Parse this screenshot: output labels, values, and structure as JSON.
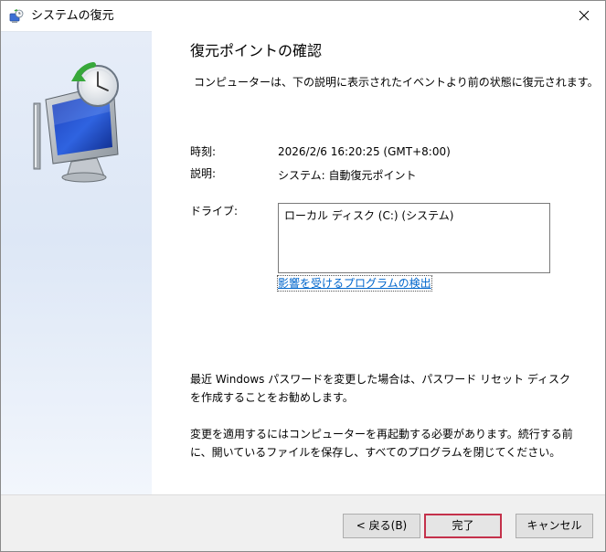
{
  "window": {
    "title": "システムの復元",
    "close_label": "×"
  },
  "icons": {
    "title": "system-restore-icon",
    "hero": "monitor-clock-restore-icon",
    "close": "close-icon"
  },
  "colors": {
    "side_panel": "#dde7f6",
    "link": "#0066cc",
    "primary_border": "#c4314b",
    "footer": "#f0f0f0"
  },
  "main": {
    "heading": "復元ポイントの確認",
    "description": "コンピューターは、下の説明に表示されたイベントより前の状態に復元されます。",
    "time_label": "時刻:",
    "time_value": "2026/2/6 16:20:25 (GMT+8:00)",
    "desc_label": "説明:",
    "desc_value": "システム: 自動復元ポイント",
    "drive_label": "ドライブ:",
    "drives": [
      "ローカル ディスク (C:) (システム)"
    ],
    "scan_link": "影響を受けるプログラムの検出",
    "password_note": "最近 Windows パスワードを変更した場合は、パスワード リセット ディスクを作成することをお勧めします。",
    "restart_note": "変更を適用するにはコンピューターを再起動する必要があります。続行する前に、開いているファイルを保存し、すべてのプログラムを閉じてください。"
  },
  "buttons": {
    "back": "< 戻る(B)",
    "finish": "完了",
    "cancel": "キャンセル"
  }
}
